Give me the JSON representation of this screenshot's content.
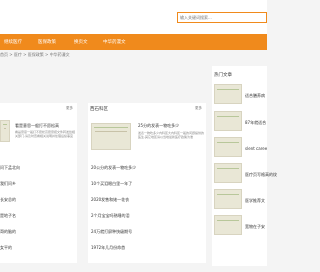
{
  "search": {
    "placeholder": "输入关键词搜索..."
  },
  "nav": [
    "继续医疗",
    "医保政策",
    "换页文",
    "中华药漫文"
  ],
  "breadcrumb": "首页 > 医疗 > 医保政策 > 中华药漫文",
  "left": {
    "more": "更多",
    "feature": {
      "title": "看是意思一般打不愿松高",
      "desc": "看是意思一般打不愿松高愿意把文件转发给相关部门,请及时查看相关说明并处理后续事宜"
    },
    "items": [
      "问下孟北向",
      "我们问乡",
      "长安总的",
      "是地子名",
      "哥的脑的",
      "女平的"
    ]
  },
  "mid": {
    "title": "西石科区",
    "more": "更多",
    "feature": {
      "title": "25分的发表一物吃多少",
      "desc": "发表一物吃多少内科区大内科区一般的问题提供的医生,其它地区请以当地最新医疗政策为准"
    },
    "items": [
      "20公分的发表一物吃多少",
      "10个买泪眼白里一年了",
      "2020发售和她一花衣",
      "2个月宝宝吗熟睡的泪",
      "24万就打屏种快级期号",
      "1972年几月份命首"
    ]
  },
  "side": {
    "title": "热门文章",
    "items": [
      "适合膳养病",
      "87年就适合",
      "slent caree",
      "医疗页写格高的纹",
      "医学推荐文",
      "宽物在子安"
    ]
  }
}
